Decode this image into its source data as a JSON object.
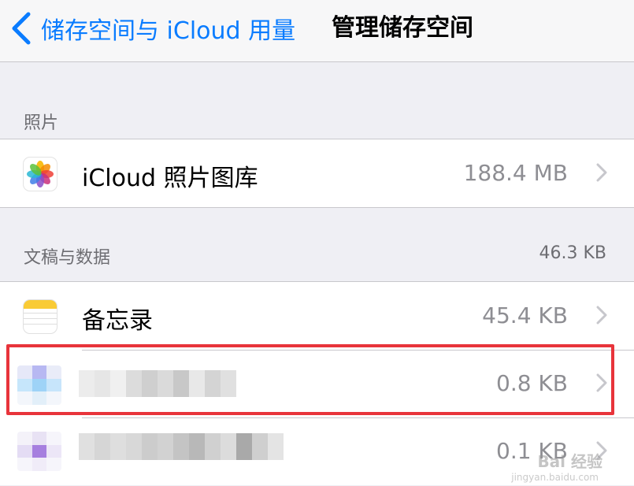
{
  "nav": {
    "back_label": "储存空间与 iCloud 用量",
    "title": "管理储存空间"
  },
  "sections": {
    "photos": {
      "header": "照片",
      "items": [
        {
          "title": "iCloud 照片图库",
          "value": "188.4 MB",
          "icon": "photos-icon"
        }
      ]
    },
    "documents": {
      "header": "文稿与数据",
      "total": "46.3 KB",
      "items": [
        {
          "title": "备忘录",
          "value": "45.4 KB",
          "icon": "notes-icon"
        },
        {
          "title": "",
          "value": "0.8 KB",
          "icon": "blurred-app-icon"
        },
        {
          "title": "",
          "value": "0.1 KB",
          "icon": "blurred-app-icon"
        }
      ]
    }
  },
  "colors": {
    "accent": "#0a7cff",
    "highlight": "#e8343b",
    "background": "#efeff4"
  },
  "watermark": {
    "text": "Bai 经验",
    "sub": "jingyan.baidu.com"
  }
}
